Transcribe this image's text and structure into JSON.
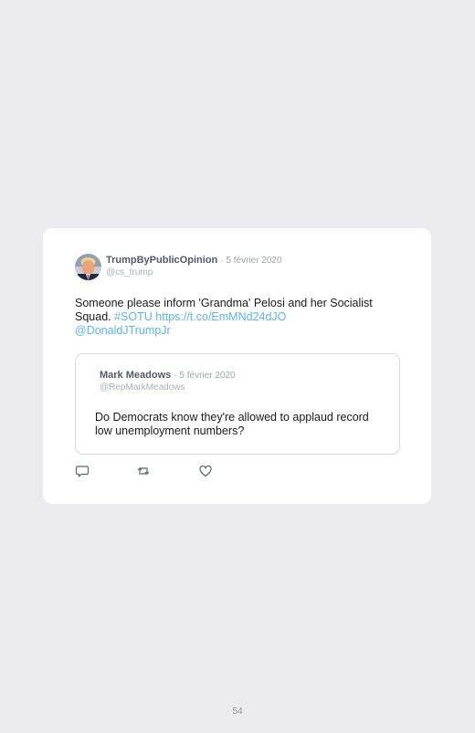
{
  "tweet": {
    "author_name": "TrumpByPublicOpinion",
    "date": "· 5 février 2020",
    "handle": "@cs_trump",
    "text_main": "Someone please inform 'Grandma' Pelosi and her Socialist Squad.",
    "hashtag": "#SOTU",
    "url": "https://t.co/EmMNd24dJO",
    "mention": "@DonaldJTrumpJr"
  },
  "quoted": {
    "author_name": "Mark Meadows",
    "date": "· 5 février 2020",
    "handle": "@RepMarkMeadows",
    "text": "Do Democrats know they're allowed to applaud record low unemployment numbers?"
  },
  "actions": {
    "reply_icon": "reply-icon",
    "retweet_icon": "retweet-icon",
    "like_icon": "heart-icon"
  },
  "page": {
    "number": "54"
  },
  "colors": {
    "background": "#ebeaef",
    "card": "#ffffff",
    "link": "#5ab4e8",
    "name": "#4f5c68",
    "muted": "#a6afb7"
  }
}
